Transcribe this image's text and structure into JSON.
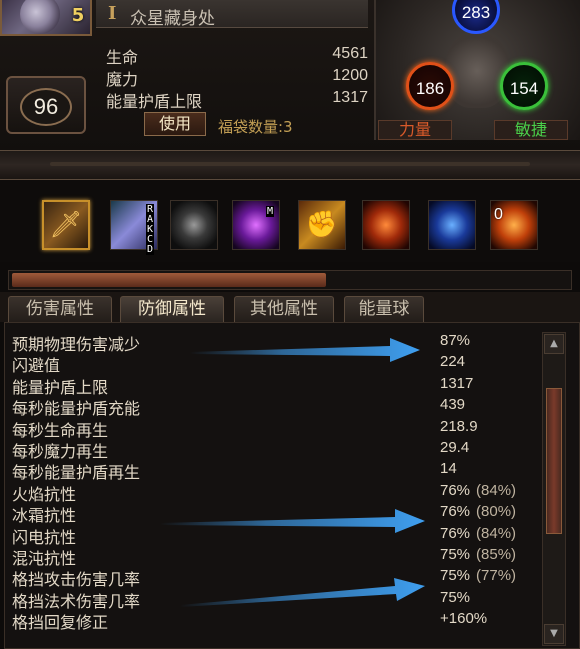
{
  "character": {
    "name": "众星藏身处",
    "rank_badge": "5",
    "level": "96"
  },
  "stats_top": [
    {
      "label": "生命",
      "value": "4561"
    },
    {
      "label": "魔力",
      "value": "1200"
    },
    {
      "label": "能量护盾上限",
      "value": "1317"
    }
  ],
  "use_button": "使用",
  "bag_count": "福袋数量:3",
  "attributes": {
    "intelligence": "283",
    "strength": "186",
    "dexterity": "154",
    "strength_label": "力量",
    "dexterity_label": "敏捷",
    "colors": {
      "intelligence": "#2a58ff",
      "strength": "#e05018",
      "dexterity": "#3ac03a"
    }
  },
  "skill_slots": {
    "selected_index": 0,
    "badge_letters": [
      "R",
      "A",
      "K",
      "C",
      "D"
    ],
    "badge_m": "M",
    "count_text": "0"
  },
  "progress_fraction": 0.565,
  "tabs": [
    "伤害属性",
    "防御属性",
    "其他属性",
    "能量球"
  ],
  "active_tab": 1,
  "defense_stats": [
    {
      "label": "预期物理伤害减少",
      "value": "87%"
    },
    {
      "label": "闪避值",
      "value": "224"
    },
    {
      "label": "能量护盾上限",
      "value": "1317"
    },
    {
      "label": "每秒能量护盾充能",
      "value": "439"
    },
    {
      "label": "每秒生命再生",
      "value": "218.9"
    },
    {
      "label": "每秒魔力再生",
      "value": "29.4"
    },
    {
      "label": "每秒能量护盾再生",
      "value": "14"
    },
    {
      "label": "火焰抗性",
      "value": "76%",
      "sub": "(84%)"
    },
    {
      "label": "冰霜抗性",
      "value": "76%",
      "sub": "(80%)"
    },
    {
      "label": "闪电抗性",
      "value": "76%",
      "sub": "(84%)"
    },
    {
      "label": "混沌抗性",
      "value": "75%",
      "sub": "(85%)"
    },
    {
      "label": "格挡攻击伤害几率",
      "value": "75%",
      "sub": "(77%)"
    },
    {
      "label": "格挡法术伤害几率",
      "value": "75%"
    },
    {
      "label": "格挡回复修正",
      "value": "+160%"
    }
  ],
  "arrow_color": "#3f9ff0"
}
